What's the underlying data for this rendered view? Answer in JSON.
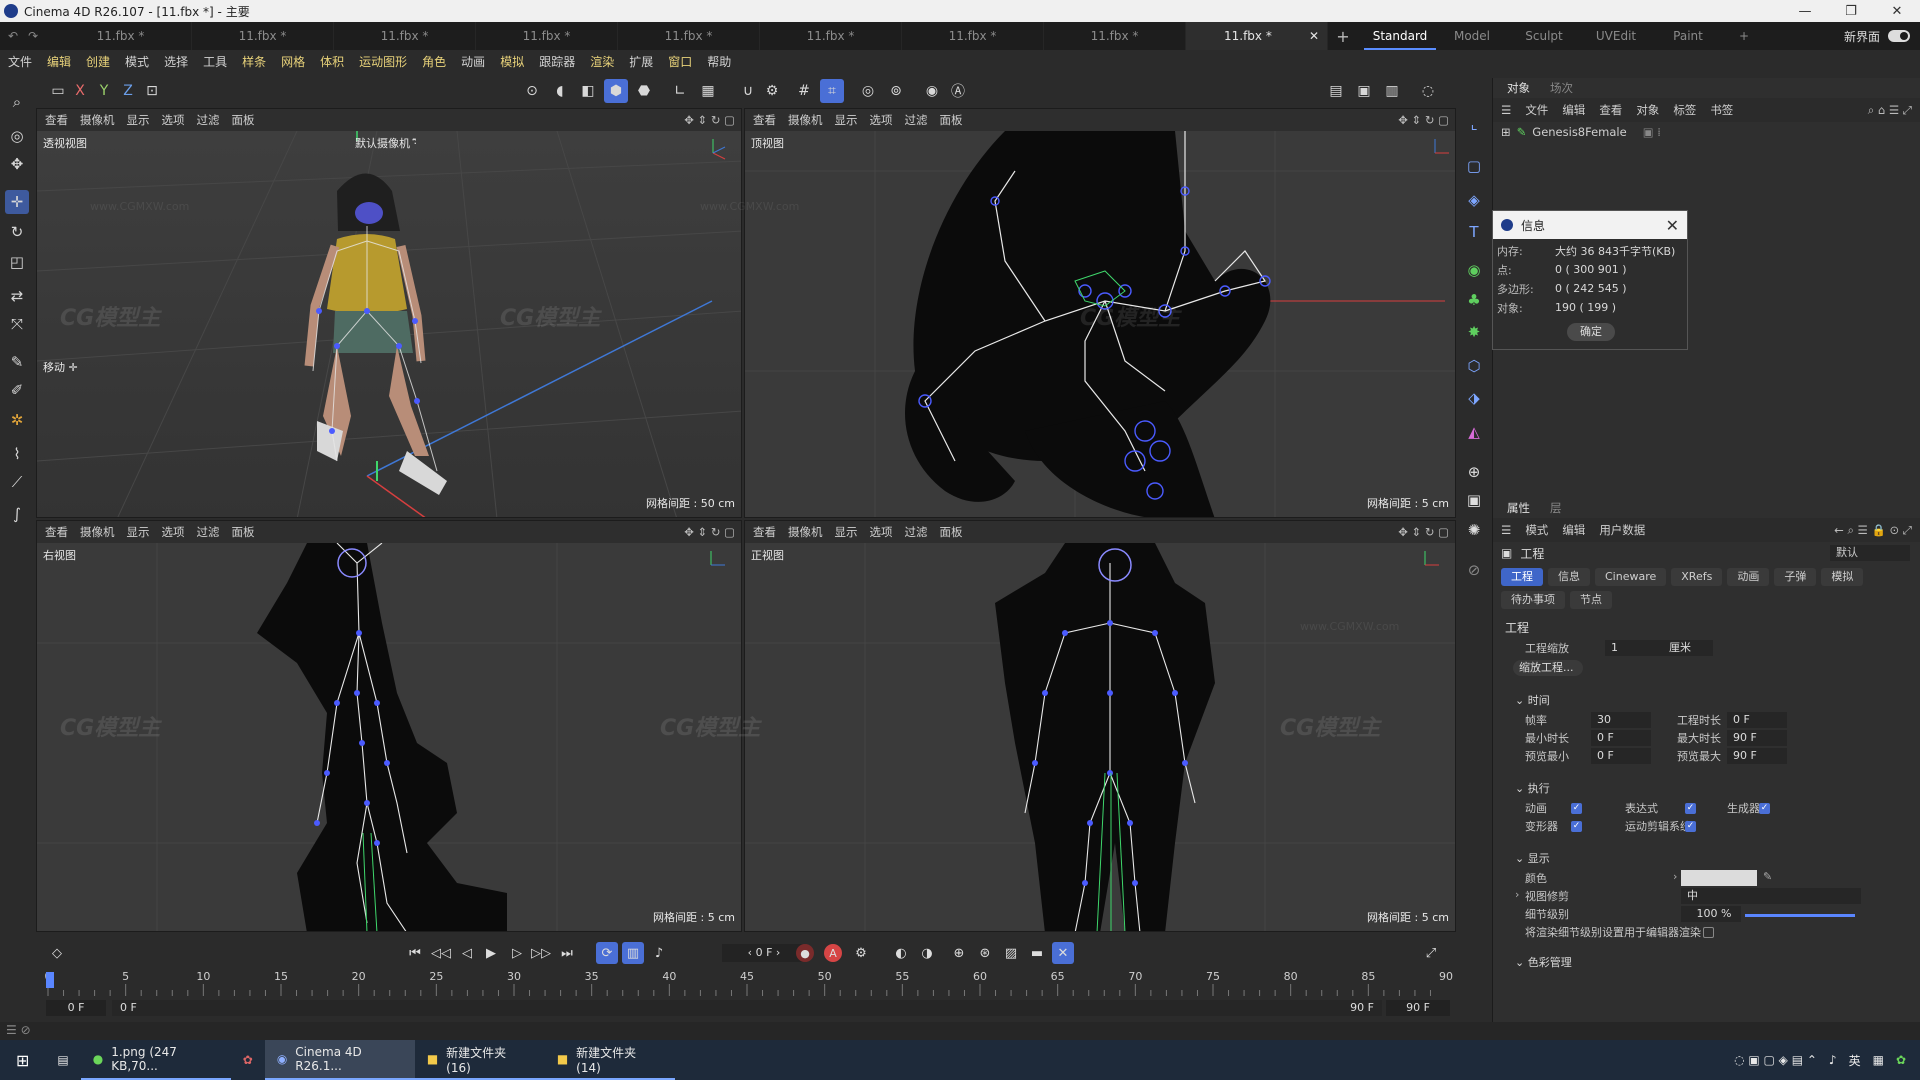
{
  "window": {
    "title": "Cinema 4D R26.107 - [11.fbx *] - 主要",
    "controls": [
      "—",
      "❐",
      "✕"
    ]
  },
  "tabs": {
    "documents": [
      "11.fbx *",
      "11.fbx *",
      "11.fbx *",
      "11.fbx *",
      "11.fbx *",
      "11.fbx *",
      "11.fbx *",
      "11.fbx *",
      "11.fbx *"
    ],
    "active_doc": "11.fbx *",
    "close": "✕",
    "add": "+",
    "layouts": [
      "Standard",
      "Model",
      "Sculpt",
      "UVEdit",
      "Paint"
    ],
    "layout_add": "+",
    "new_ui": "新界面"
  },
  "menu": [
    "文件",
    "编辑",
    "创建",
    "模式",
    "选择",
    "工具",
    "样条",
    "网格",
    "体积",
    "运动图形",
    "角色",
    "动画",
    "模拟",
    "跟踪器",
    "渲染",
    "扩展",
    "窗口",
    "帮助"
  ],
  "axis_toolbar": [
    "X",
    "Y",
    "Z"
  ],
  "viewports": {
    "menu": [
      "查看",
      "摄像机",
      "显示",
      "选项",
      "过滤",
      "面板"
    ],
    "perspective": {
      "name": "透视视图",
      "camera": "默认摄像机 ·̂͂",
      "grid": "网格间距 : 50 cm",
      "tool": "移动 ✛"
    },
    "top": {
      "name": "顶视图",
      "grid": "网格间距 : 5 cm"
    },
    "right": {
      "name": "右视图",
      "grid": "网格间距 : 5 cm"
    },
    "front": {
      "name": "正视图",
      "grid": "网格间距 : 5 cm"
    },
    "watermark_logo": "CG模型主",
    "watermark_url": "www.CGMXW.com"
  },
  "object_manager": {
    "tabs": [
      "对象",
      "场次"
    ],
    "menu": [
      "文件",
      "编辑",
      "查看",
      "对象",
      "标签",
      "书签"
    ],
    "objects": [
      {
        "name": "Genesis8Female"
      }
    ]
  },
  "info_dialog": {
    "title": "信息",
    "rows": [
      {
        "k": "内存:",
        "v": "大约 36 843千字节(KB)"
      },
      {
        "k": "点:",
        "v": "0 ( 300 901 )"
      },
      {
        "k": "多边形:",
        "v": "0 ( 242 545 )"
      },
      {
        "k": "对象:",
        "v": "190 ( 199 )"
      }
    ],
    "ok": "确定"
  },
  "attribute_manager": {
    "tabs": [
      "属性",
      "层"
    ],
    "menu": [
      "模式",
      "编辑",
      "用户数据"
    ],
    "object_title": "工程",
    "preset": "默认",
    "subtabs": [
      "工程",
      "信息",
      "Cineware",
      "XRefs",
      "动画",
      "子弹",
      "模拟",
      "待办事项",
      "节点"
    ],
    "section": "工程",
    "scale_label": "工程缩放",
    "scale_value": "1",
    "scale_unit": "厘米",
    "scale_btn": "缩放工程...",
    "time_group": "时间",
    "fps_label": "帧率",
    "fps_value": "30",
    "duration_label": "工程时长",
    "duration_value": "0 F",
    "min_label": "最小时长",
    "min_value": "0 F",
    "max_label": "最大时长",
    "max_value": "90 F",
    "pmin_label": "预览最小",
    "pmin_value": "0 F",
    "pmax_label": "预览最大",
    "pmax_value": "90 F",
    "exec_group": "执行",
    "exec": {
      "anim": "动画",
      "expr": "表达式",
      "gen": "生成器",
      "deform": "变形器",
      "motion": "运动剪辑系统"
    },
    "display_group": "显示",
    "color_label": "颜色",
    "clip_label": "视图修剪",
    "clip_value": "中",
    "lod_label": "细节级别",
    "lod_value": "100 %",
    "lod_fraction": 1.0,
    "render_lod_label": "将渲染细节级别设置用于编辑器渲染",
    "color_mgmt_group": "色彩管理"
  },
  "timeline": {
    "current_frame": "0 F",
    "ruler_ticks": [
      "0",
      "5",
      "10",
      "15",
      "20",
      "25",
      "30",
      "35",
      "40",
      "45",
      "50",
      "55",
      "60",
      "65",
      "70",
      "75",
      "80",
      "85",
      "90"
    ],
    "range_start": "0 F",
    "range_start2": "0 F",
    "range_end": "90 F",
    "range_end2": "90 F"
  },
  "taskbar": {
    "items": [
      {
        "label": "1.png (247 KB,70..."
      },
      {
        "label": "Cinema 4D R26.1..."
      },
      {
        "label": "新建文件夹 (16)"
      },
      {
        "label": "新建文件夹 (14)"
      }
    ],
    "ime": "英"
  },
  "colors": {
    "accent": "#4a6fd6",
    "viewport_bg": "#3a3a3a",
    "panel_bg": "#2f2f2f",
    "skeleton": "#e8e8e8",
    "joint": "#4b5bff"
  }
}
